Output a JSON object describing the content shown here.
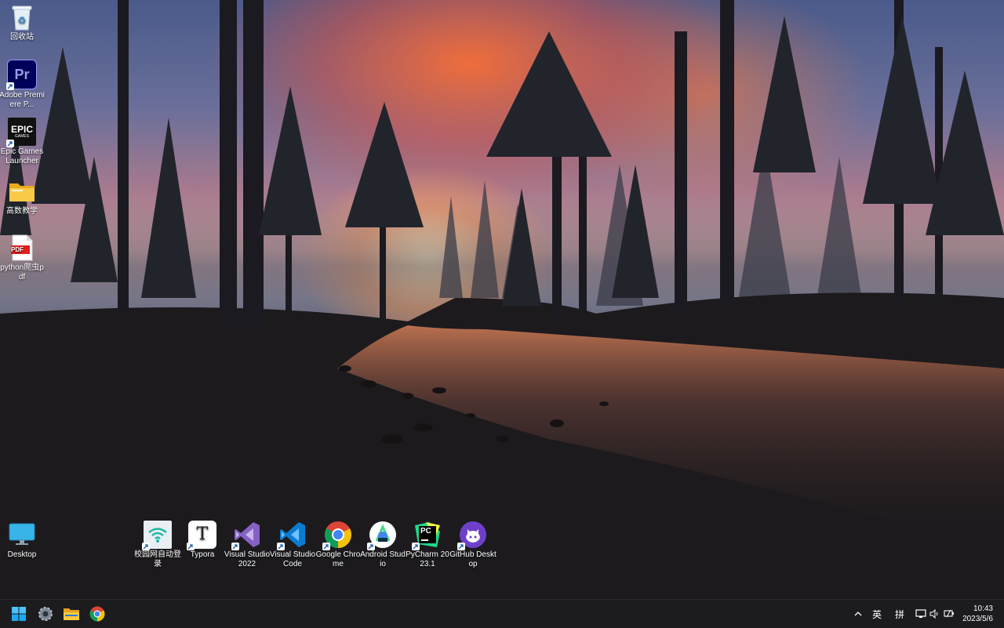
{
  "desktop": {
    "left_icons": [
      {
        "label": "回收站",
        "icon": "recycle-bin-icon"
      },
      {
        "label": "Adobe Premiere P...",
        "icon": "premiere-pro-icon"
      },
      {
        "label": "Epic Games Launcher",
        "icon": "epic-games-icon"
      },
      {
        "label": "高数教学",
        "icon": "folder-icon"
      },
      {
        "label": "python爬虫pdf",
        "icon": "pdf-icon"
      }
    ],
    "bottom_icons": [
      {
        "label": "Desktop",
        "icon": "monitor-icon"
      },
      {
        "label": "校园网自动登录",
        "icon": "wifi-app-icon"
      },
      {
        "label": "Typora",
        "icon": "typora-icon"
      },
      {
        "label": "Visual Studio 2022",
        "icon": "visual-studio-icon"
      },
      {
        "label": "Visual Studio Code",
        "icon": "vscode-icon"
      },
      {
        "label": "Google Chrome",
        "icon": "chrome-icon"
      },
      {
        "label": "Android Studio",
        "icon": "android-studio-icon"
      },
      {
        "label": "PyCharm 2023.1",
        "icon": "pycharm-icon"
      },
      {
        "label": "GitHub Desktop",
        "icon": "github-desktop-icon"
      }
    ],
    "epic_logo_text": "EPIC",
    "epic_logo_sub": "GAMES",
    "premiere_logo_text": "Pr",
    "pdf_logo_text": "PDF",
    "pycharm_logo_text": "PC",
    "typora_logo_text": "T"
  },
  "taskbar": {
    "pinned": [
      {
        "name": "start",
        "icon": "windows-start-icon"
      },
      {
        "name": "settings",
        "icon": "gear-icon"
      },
      {
        "name": "file-explorer",
        "icon": "folder-icon"
      },
      {
        "name": "chrome",
        "icon": "chrome-icon"
      }
    ],
    "tray": {
      "overflow_icon": "chevron-up-icon",
      "input_lang": "英",
      "input_mode": "拼",
      "time": "10:43",
      "date": "2023/5/6"
    }
  },
  "colors": {
    "taskbar_bg": "#1c1c1e",
    "accent": "#4cc2ff"
  }
}
